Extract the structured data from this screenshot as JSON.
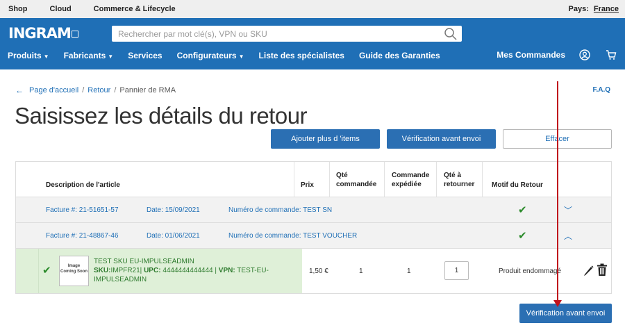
{
  "topbar": {
    "links": [
      "Shop",
      "Cloud",
      "Commerce & Lifecycle"
    ],
    "country_label": "Pays:",
    "country_value": "France"
  },
  "header": {
    "logo": "INGRAM",
    "search_placeholder": "Rechercher par mot clé(s), VPN ou SKU",
    "nav": [
      "Produits",
      "Fabricants",
      "Services",
      "Configurateurs",
      "Liste des spécialistes",
      "Guide des Garanties"
    ],
    "orders": "Mes Commandes"
  },
  "breadcrumb": {
    "home": "Page d'accueil",
    "retour": "Retour",
    "current": "Pannier de RMA"
  },
  "faq": "F.A.Q",
  "title": "Saisissez les détails du retour",
  "buttons": {
    "add_more": "Ajouter plus d 'items",
    "verify": "Vérification avant envoi",
    "clear": "Effacer",
    "verify_bottom": "Vérification avant envoi"
  },
  "table": {
    "headers": {
      "description": "Description de l'article",
      "price": "Prix",
      "qty_ordered": "Qté commandée",
      "ordered_shipped": "Commande expédiée",
      "qty_return": "Qté à retourner",
      "reason": "Motif du Retour"
    },
    "groups": [
      {
        "invoice": "Facture #: 21-51651-57",
        "date": "Date: 15/09/2021",
        "order": "Numéro de commande: TEST SN"
      },
      {
        "invoice": "Facture #: 21-48867-46",
        "date": "Date: 01/06/2021",
        "order": "Numéro de commande: TEST VOUCHER"
      }
    ],
    "item": {
      "thumb": "Image Coming Soon",
      "name": "TEST SKU EU-IMPULSEADMIN",
      "sku_label": "SKU:",
      "sku": "IMPFR21|",
      "upc_label": "UPC:",
      "upc": "4444444444444 |",
      "vpn_label": "VPN:",
      "vpn": "TEST-EU-IMPULSEADMIN",
      "price": "1,50 €",
      "qty_ordered": "1",
      "shipped": "1",
      "qty_return": "1",
      "reason": "Produit endommagé"
    }
  },
  "icons": {
    "check": "check-icon",
    "pencil": "pencil-icon",
    "trash": "trash-icon",
    "user": "user-icon",
    "cart": "cart-icon"
  },
  "colors": {
    "brand_blue": "#1f6fb6",
    "success_green": "#2a8a2a",
    "arrow_red": "#c0121c"
  }
}
